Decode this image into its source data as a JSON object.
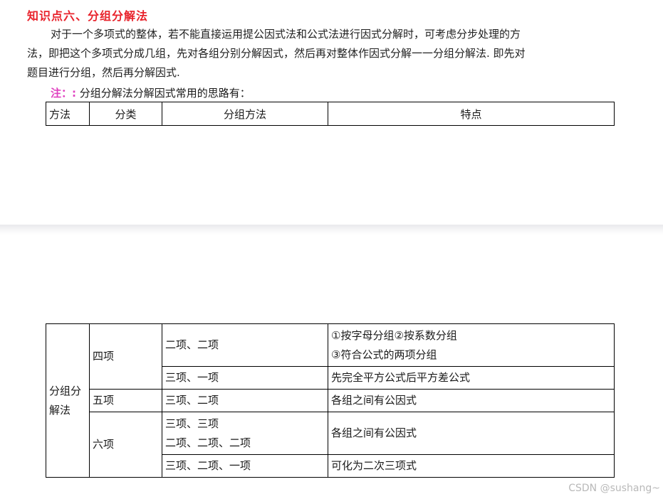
{
  "title": "知识点六、分组分解法",
  "paragraph": {
    "line1": "对于一个多项式的整体，若不能直接运用提公因式法和公式法进行因式分解时，可考虑分步处理的方",
    "line2": "法，即把这个多项式分成几组，先对各组分别分解因式，然后再对整体作因式分解一一分组分解法. 即先对",
    "line3": "题目进行分组，然后再分解因式."
  },
  "note": {
    "tag": "注：:",
    "text": "分组分解法分解因式常用的思路有："
  },
  "table_header": [
    "方法",
    "分类",
    "分组方法",
    "特点"
  ],
  "table_body": {
    "method": [
      "分组分",
      "解法"
    ],
    "rows": [
      {
        "class": "四项",
        "group": [
          "二项、二项"
        ],
        "feature": [
          "①按字母分组②按系数分组",
          "③符合公式的两项分组"
        ]
      },
      {
        "group": [
          "三项、一项"
        ],
        "feature": [
          "先完全平方公式后平方差公式"
        ]
      },
      {
        "class": "五项",
        "group": [
          "三项、二项"
        ],
        "feature": [
          "各组之间有公因式"
        ]
      },
      {
        "class": "六项",
        "group": [
          "三项、三项",
          "二项、二项、二项"
        ],
        "feature": [
          "各组之间有公因式"
        ]
      },
      {
        "group": [
          "三项、二项、一项"
        ],
        "feature": [
          "可化为二次三项式"
        ]
      }
    ]
  },
  "watermark": "CSDN @sushang~"
}
